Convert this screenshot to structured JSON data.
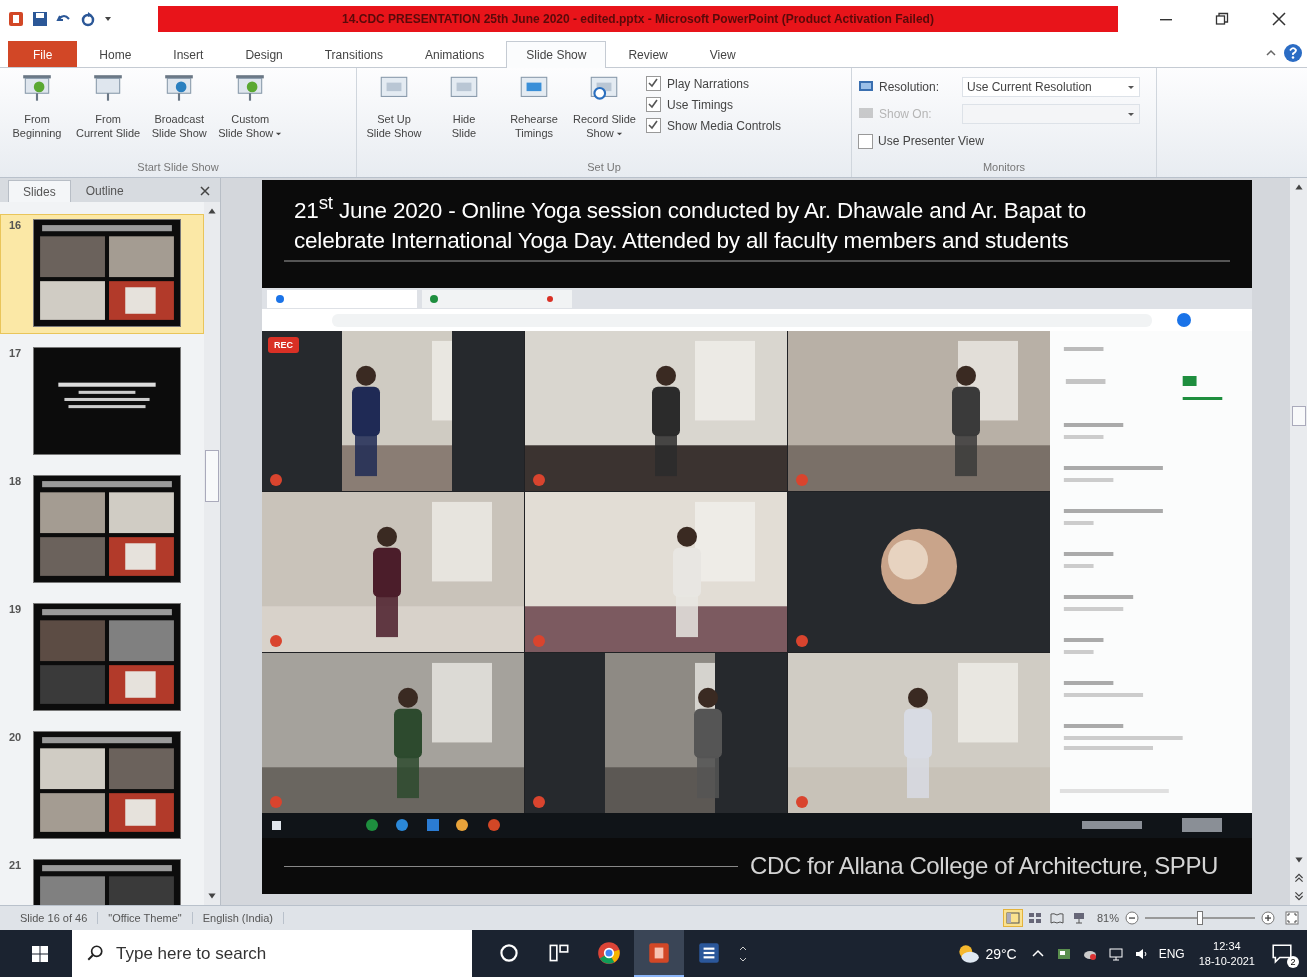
{
  "window": {
    "title": "14.CDC PRESENTATION 25th June 2020 - edited.pptx - Microsoft PowerPoint (Product Activation Failed)"
  },
  "ribbon": {
    "tabs": [
      {
        "label": "File",
        "kind": "file",
        "selected": false
      },
      {
        "label": "Home",
        "kind": "tab",
        "selected": false
      },
      {
        "label": "Insert",
        "kind": "tab",
        "selected": false
      },
      {
        "label": "Design",
        "kind": "tab",
        "selected": false
      },
      {
        "label": "Transitions",
        "kind": "tab",
        "selected": false
      },
      {
        "label": "Animations",
        "kind": "tab",
        "selected": false
      },
      {
        "label": "Slide Show",
        "kind": "tab",
        "selected": true
      },
      {
        "label": "Review",
        "kind": "tab",
        "selected": false
      },
      {
        "label": "View",
        "kind": "tab",
        "selected": false
      }
    ],
    "start_group": {
      "label": "Start Slide Show",
      "buttons": [
        {
          "lines": [
            "From",
            "Beginning"
          ],
          "dropdown": false
        },
        {
          "lines": [
            "From",
            "Current Slide"
          ],
          "dropdown": false
        },
        {
          "lines": [
            "Broadcast",
            "Slide Show"
          ],
          "dropdown": false
        },
        {
          "lines": [
            "Custom",
            "Slide Show"
          ],
          "dropdown": true
        }
      ]
    },
    "setup_group": {
      "label": "Set Up",
      "buttons": [
        {
          "lines": [
            "Set Up",
            "Slide Show"
          ],
          "dropdown": false
        },
        {
          "lines": [
            "Hide",
            "Slide"
          ],
          "dropdown": false
        },
        {
          "lines": [
            "Rehearse",
            "Timings"
          ],
          "dropdown": false
        },
        {
          "lines": [
            "Record Slide",
            "Show"
          ],
          "dropdown": true
        }
      ],
      "checks": [
        {
          "label": "Play Narrations",
          "checked": true
        },
        {
          "label": "Use Timings",
          "checked": true
        },
        {
          "label": "Show Media Controls",
          "checked": true
        }
      ]
    },
    "monitors_group": {
      "label": "Monitors",
      "resolution": {
        "label": "Resolution:",
        "value": "Use Current Resolution"
      },
      "show_on": {
        "label": "Show On:",
        "disabled": true
      },
      "presenter_view": {
        "label": "Use Presenter View",
        "checked": false
      }
    }
  },
  "panel": {
    "tabs": [
      {
        "label": "Slides",
        "selected": true
      },
      {
        "label": "Outline",
        "selected": false
      }
    ],
    "slides": [
      {
        "number": "16",
        "kind": "photos",
        "selected": true
      },
      {
        "number": "17",
        "kind": "text",
        "selected": false
      },
      {
        "number": "18",
        "kind": "photos",
        "selected": false
      },
      {
        "number": "19",
        "kind": "photos",
        "selected": false
      },
      {
        "number": "20",
        "kind": "photos",
        "selected": false
      },
      {
        "number": "21",
        "kind": "photos",
        "selected": false
      }
    ]
  },
  "slide": {
    "title": "21$^{st}$ June 2020 - Online Yoga session conducted by Ar. Dhawale and Ar. Bapat to celebrate International Yoga Day. Attended by all faculty members and students",
    "rec_badge": "REC",
    "tiles": [
      {
        "kind": "video"
      },
      {
        "kind": "video"
      },
      {
        "kind": "video"
      },
      {
        "kind": "video"
      },
      {
        "kind": "video"
      },
      {
        "kind": "avatar"
      },
      {
        "kind": "video"
      },
      {
        "kind": "video"
      },
      {
        "kind": "video"
      }
    ],
    "footer": "CDC for Allana College of Architecture, SPPU"
  },
  "status_bar": {
    "slide": "Slide 16 of 46",
    "theme": "\"Office Theme\"",
    "language": "English (India)",
    "views": [
      {
        "kind": "normal",
        "selected": true
      },
      {
        "kind": "sorter",
        "selected": false
      },
      {
        "kind": "reading",
        "selected": false
      },
      {
        "kind": "slideshow",
        "selected": false
      }
    ],
    "zoom": "81%",
    "zoom_slider": {
      "level": 0.5
    }
  },
  "taskbar": {
    "search": {
      "placeholder": "Type here to search"
    },
    "apps": [
      {
        "kind": "cortana",
        "selected": false
      },
      {
        "kind": "taskview",
        "selected": false
      },
      {
        "kind": "chrome",
        "selected": false
      },
      {
        "kind": "powerpoint",
        "selected": true
      },
      {
        "kind": "word",
        "selected": false
      }
    ],
    "weather": "29°C",
    "language": "ENG",
    "time": "12:34",
    "date": "18-10-2021",
    "notifications": "2"
  }
}
